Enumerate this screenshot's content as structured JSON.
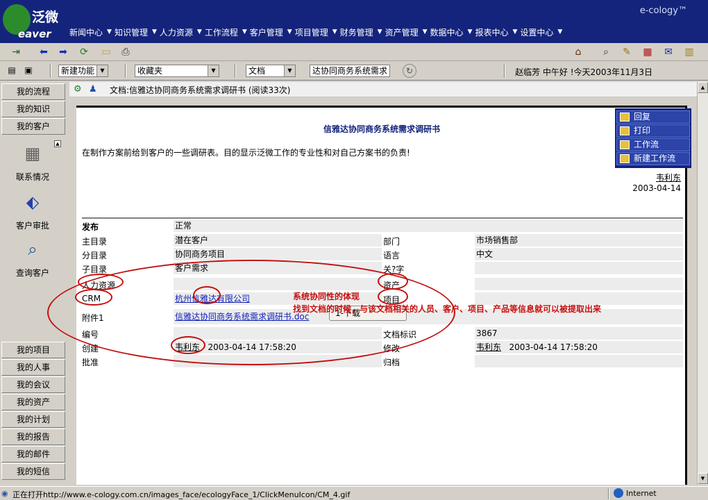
{
  "brand": {
    "logo_cn": "泛微",
    "logo_en": "eaver",
    "product": "e-cology™"
  },
  "menu": [
    "新闻中心",
    "知识管理",
    "人力资源",
    "工作流程",
    "客户管理",
    "项目管理",
    "财务管理",
    "资产管理",
    "数据中心",
    "报表中心",
    "设置中心"
  ],
  "toolbar2": {
    "new_func": "新建功能",
    "favorites": "收藏夹",
    "doc_type": "文档",
    "search_value": "达协同商务系统需求",
    "greeting": "赵临芳 中午好 !今天2003年11月3日"
  },
  "sidebar": {
    "top": [
      "我的流程",
      "我的知识",
      "我的客户"
    ],
    "items": [
      "联系情况",
      "客户审批",
      "查询客户"
    ],
    "bottom": [
      "我的项目",
      "我的人事",
      "我的会议",
      "我的资产",
      "我的计划",
      "我的报告",
      "我的邮件",
      "我的短信"
    ]
  },
  "crumb": "文档:信雅达协同商务系统需求调研书 (阅读33次)",
  "doc": {
    "title": "信雅达协同商务系统需求调研书",
    "desc": "在制作方案前给到客户的一些调研表。目的显示泛微工作的专业性和对自己方案书的负责!",
    "author": "韦利东",
    "date": "2003-04-14",
    "publish_label": "发布",
    "publish_value": "正常",
    "fields": {
      "main_dir_label": "主目录",
      "main_dir": "潜在客户",
      "dept_label": "部门",
      "dept": "市场销售部",
      "sub_dir_label": "分目录",
      "sub_dir": "协同商务项目",
      "lang_label": "语言",
      "lang": "中文",
      "child_dir_label": "子目录",
      "child_dir": "客户需求",
      "keyword_label": "关?字",
      "hr_label": "人力资源",
      "asset_label": "资产",
      "crm_label": "CRM",
      "crm": "杭州信雅达有限公司",
      "project_label": "项目",
      "attach_label": "附件1",
      "attach": "信雅达协同商务系统需求调研书.doc",
      "download": "1-下载",
      "number_label": "编号",
      "doc_id_label": "文档标识",
      "doc_id": "3867",
      "create_label": "创建",
      "creator": "韦利东",
      "create_time": "2003-04-14 17:58:20",
      "modify_label": "修改",
      "modifier": "韦利东",
      "modify_time": "2003-04-14 17:58:20",
      "approve_label": "批准",
      "archive_label": "归档"
    }
  },
  "actions": [
    "回复",
    "打印",
    "工作流",
    "新建工作流"
  ],
  "annotations": {
    "line1": "系统协同性的体现",
    "line2": "找到文档的时候，与该文档相关的人员、客户、项目、产品等信息就可以被提取出来"
  },
  "status": {
    "left": "正在打开http://www.e-cology.com.cn/images_face/ecologyFace_1/ClickMenuIcon/CM_4.gif",
    "right": "Internet"
  }
}
